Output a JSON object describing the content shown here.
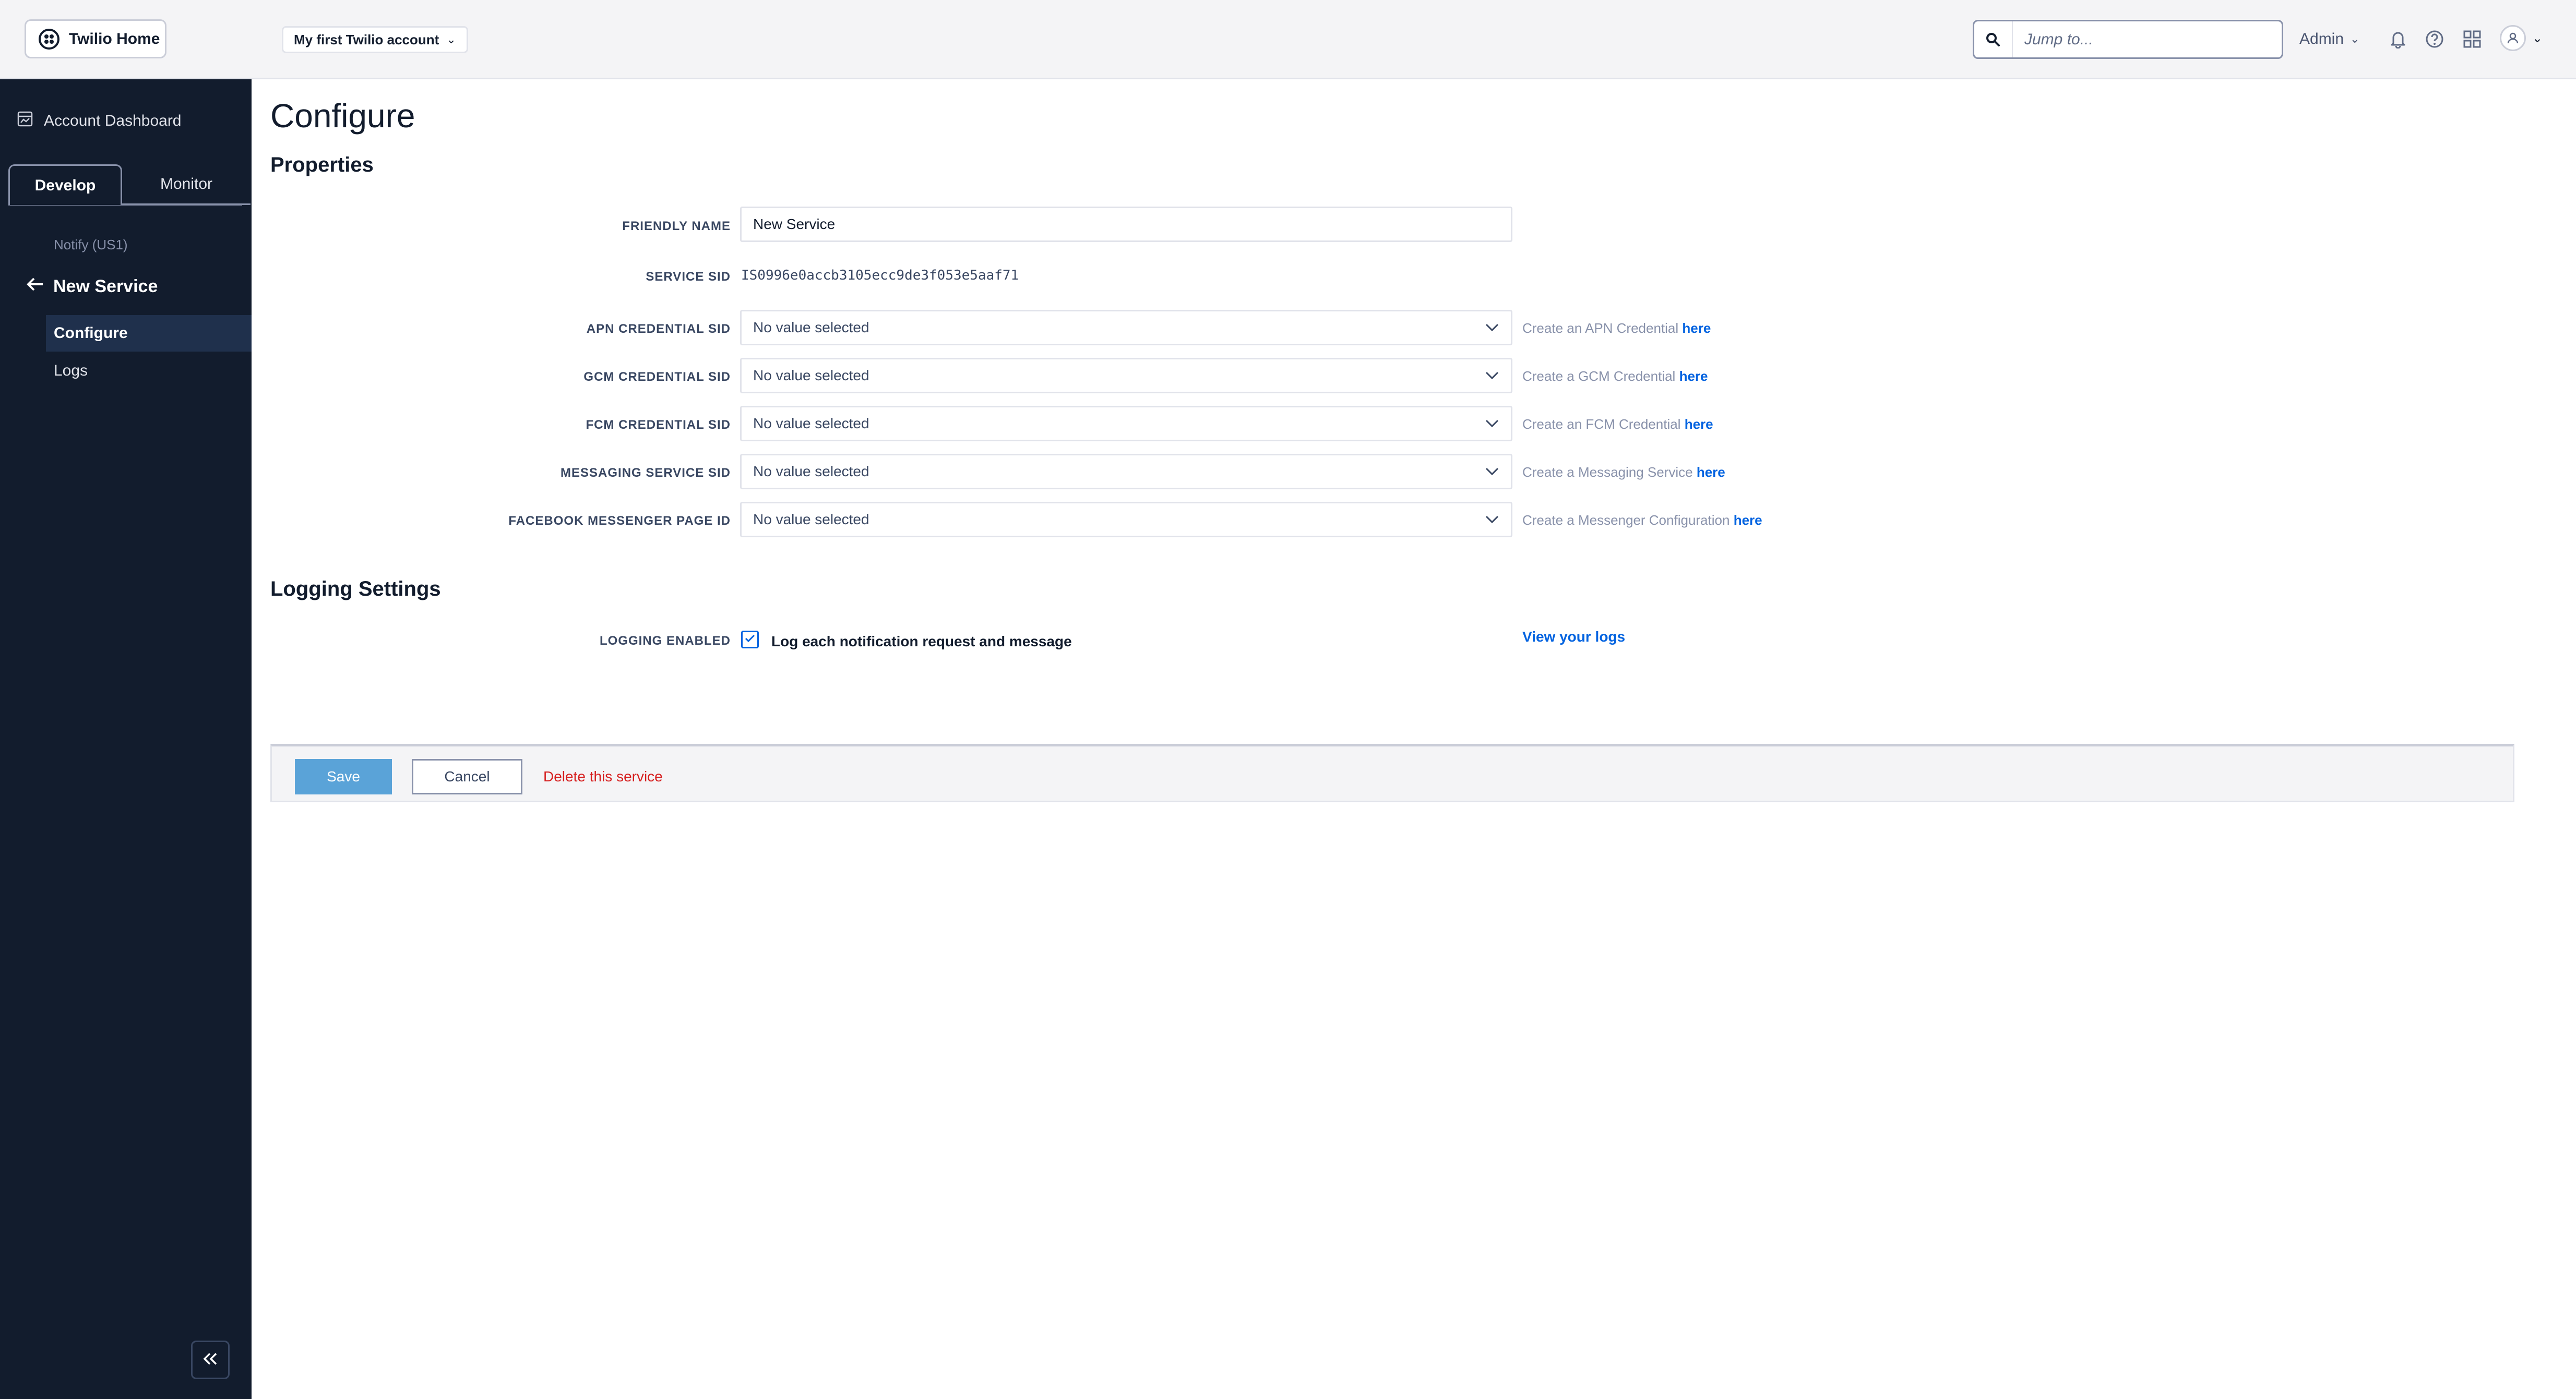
{
  "topbar": {
    "home_label": "Twilio Home",
    "account_name": "My first Twilio account",
    "search_placeholder": "Jump to...",
    "admin_label": "Admin"
  },
  "sidebar": {
    "account_dashboard": "Account Dashboard",
    "tabs": [
      {
        "label": "Develop",
        "active": true
      },
      {
        "label": "Monitor",
        "active": false
      }
    ],
    "section": "Notify (US1)",
    "back_title": "New Service",
    "items": [
      {
        "label": "Configure",
        "active": true
      },
      {
        "label": "Logs",
        "active": false
      }
    ]
  },
  "main": {
    "title": "Configure",
    "properties_title": "Properties",
    "fields": {
      "friendly_name_label": "FRIENDLY NAME",
      "friendly_name_value": "New Service",
      "service_sid_label": "SERVICE SID",
      "service_sid_value": "IS0996e0accb3105ecc9de3f053e5aaf71"
    },
    "selects": [
      {
        "label": "APN CREDENTIAL SID",
        "value": "No value selected",
        "hint": "Create an APN Credential",
        "link": "here"
      },
      {
        "label": "GCM CREDENTIAL SID",
        "value": "No value selected",
        "hint": "Create a GCM Credential",
        "link": "here"
      },
      {
        "label": "FCM CREDENTIAL SID",
        "value": "No value selected",
        "hint": "Create an FCM Credential",
        "link": "here"
      },
      {
        "label": "MESSAGING SERVICE SID",
        "value": "No value selected",
        "hint": "Create a Messaging Service",
        "link": "here"
      },
      {
        "label": "FACEBOOK MESSENGER PAGE ID",
        "value": "No value selected",
        "hint": "Create a Messenger Configuration",
        "link": "here"
      }
    ],
    "logging_title": "Logging Settings",
    "logging": {
      "label": "LOGGING ENABLED",
      "checkbox_label": "Log each notification request and message",
      "checked": true,
      "view_logs": "View your logs"
    },
    "actions": {
      "save": "Save",
      "cancel": "Cancel",
      "delete": "Delete this service"
    }
  },
  "colors": {
    "sidebar_bg": "#121c2d",
    "link": "#0263e0",
    "save_button": "#5aa3d8",
    "danger": "#d61f1f"
  }
}
